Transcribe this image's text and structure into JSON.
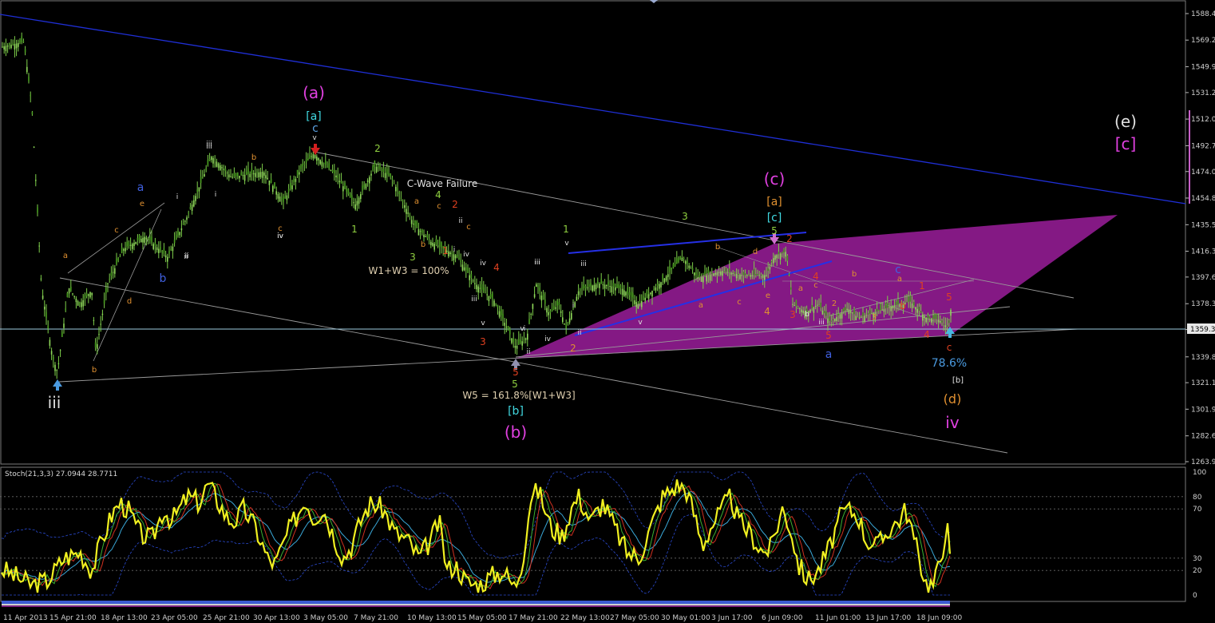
{
  "chart_data": {
    "type": "candlestick",
    "price_axis": {
      "ticks": [
        "1588.4",
        "1569.2",
        "1549.9",
        "1531.2",
        "1512.0",
        "1492.7",
        "1474.0",
        "1454.8",
        "1435.5",
        "1416.3",
        "1397.6",
        "1378.3",
        "1359.6",
        "1339.8",
        "1321.1",
        "1301.9",
        "1282.6",
        "1263.9"
      ],
      "range": [
        1259,
        1593
      ],
      "current_price_label": "1359.3"
    },
    "time_axis": {
      "labels": [
        "11 Apr 2013",
        "15 Apr 21:00",
        "18 Apr 13:00",
        "23 Apr 05:00",
        "25 Apr 21:00",
        "30 Apr 13:00",
        "3 May 05:00",
        "7 May 21:00",
        "10 May 13:00",
        "15 May 05:00",
        "17 May 21:00",
        "22 May 13:00",
        "27 May 05:00",
        "30 May 01:00",
        "3 Jun 17:00",
        "6 Jun 09:00",
        "11 Jun 01:00",
        "13 Jun 17:00",
        "18 Jun 09:00"
      ]
    },
    "price_path": [
      [
        0,
        1564
      ],
      [
        30,
        1568
      ],
      [
        40,
        1520
      ],
      [
        52,
        1390
      ],
      [
        66,
        1339
      ],
      [
        72,
        1329
      ],
      [
        86,
        1390
      ],
      [
        100,
        1378
      ],
      [
        115,
        1388
      ],
      [
        120,
        1343
      ],
      [
        135,
        1393
      ],
      [
        155,
        1418
      ],
      [
        182,
        1427
      ],
      [
        210,
        1412
      ],
      [
        235,
        1442
      ],
      [
        265,
        1485
      ],
      [
        290,
        1470
      ],
      [
        330,
        1474
      ],
      [
        355,
        1452
      ],
      [
        378,
        1477
      ],
      [
        393,
        1487
      ],
      [
        420,
        1472
      ],
      [
        445,
        1450
      ],
      [
        470,
        1478
      ],
      [
        490,
        1470
      ],
      [
        518,
        1436
      ],
      [
        540,
        1423
      ],
      [
        572,
        1413
      ],
      [
        595,
        1393
      ],
      [
        620,
        1380
      ],
      [
        646,
        1347
      ],
      [
        660,
        1354
      ],
      [
        672,
        1393
      ],
      [
        688,
        1371
      ],
      [
        700,
        1378
      ],
      [
        709,
        1360
      ],
      [
        715,
        1370
      ],
      [
        725,
        1388
      ],
      [
        750,
        1393
      ],
      [
        780,
        1389
      ],
      [
        800,
        1378
      ],
      [
        830,
        1395
      ],
      [
        855,
        1412
      ],
      [
        875,
        1397
      ],
      [
        905,
        1402
      ],
      [
        930,
        1399
      ],
      [
        960,
        1399
      ],
      [
        970,
        1413
      ],
      [
        985,
        1416
      ],
      [
        993,
        1378
      ],
      [
        1010,
        1372
      ],
      [
        1025,
        1378
      ],
      [
        1040,
        1365
      ],
      [
        1062,
        1375
      ],
      [
        1075,
        1368
      ],
      [
        1095,
        1372
      ],
      [
        1120,
        1377
      ],
      [
        1140,
        1380
      ],
      [
        1160,
        1368
      ],
      [
        1175,
        1367
      ],
      [
        1188,
        1361
      ],
      [
        1192,
        1378
      ]
    ],
    "oscillator": {
      "label": "Stoch(21,3,3) 27.0944 28.7711",
      "levels": [
        "100",
        "80",
        "70",
        "30",
        "20",
        "0"
      ],
      "value": 27.09,
      "signal": 28.77,
      "main_series": [
        [
          0,
          22
        ],
        [
          20,
          15
        ],
        [
          40,
          8
        ],
        [
          60,
          12
        ],
        [
          80,
          30
        ],
        [
          100,
          35
        ],
        [
          115,
          20
        ],
        [
          125,
          40
        ],
        [
          140,
          65
        ],
        [
          150,
          75
        ],
        [
          160,
          70
        ],
        [
          175,
          50
        ],
        [
          190,
          45
        ],
        [
          205,
          70
        ],
        [
          215,
          60
        ],
        [
          235,
          80
        ],
        [
          250,
          75
        ],
        [
          260,
          90
        ],
        [
          270,
          80
        ],
        [
          285,
          62
        ],
        [
          295,
          60
        ],
        [
          305,
          70
        ],
        [
          320,
          55
        ],
        [
          335,
          30
        ],
        [
          345,
          25
        ],
        [
          360,
          50
        ],
        [
          372,
          65
        ],
        [
          383,
          78
        ],
        [
          392,
          63
        ],
        [
          405,
          70
        ],
        [
          420,
          45
        ],
        [
          430,
          30
        ],
        [
          440,
          40
        ],
        [
          455,
          65
        ],
        [
          465,
          75
        ],
        [
          480,
          70
        ],
        [
          495,
          50
        ],
        [
          510,
          45
        ],
        [
          525,
          30
        ],
        [
          540,
          45
        ],
        [
          550,
          60
        ],
        [
          560,
          20
        ],
        [
          570,
          25
        ],
        [
          585,
          10
        ],
        [
          600,
          8
        ],
        [
          615,
          15
        ],
        [
          630,
          20
        ],
        [
          645,
          6
        ],
        [
          655,
          30
        ],
        [
          665,
          80
        ],
        [
          675,
          85
        ],
        [
          690,
          55
        ],
        [
          705,
          48
        ],
        [
          715,
          70
        ],
        [
          725,
          80
        ],
        [
          740,
          60
        ],
        [
          755,
          75
        ],
        [
          770,
          55
        ],
        [
          785,
          35
        ],
        [
          800,
          30
        ],
        [
          815,
          55
        ],
        [
          830,
          80
        ],
        [
          850,
          90
        ],
        [
          860,
          85
        ],
        [
          870,
          65
        ],
        [
          880,
          40
        ],
        [
          890,
          55
        ],
        [
          905,
          70
        ],
        [
          915,
          80
        ],
        [
          925,
          60
        ],
        [
          940,
          50
        ],
        [
          955,
          35
        ],
        [
          965,
          38
        ],
        [
          980,
          70
        ],
        [
          990,
          55
        ],
        [
          1000,
          25
        ],
        [
          1012,
          12
        ],
        [
          1025,
          20
        ],
        [
          1040,
          40
        ],
        [
          1050,
          60
        ],
        [
          1060,
          70
        ],
        [
          1075,
          65
        ],
        [
          1085,
          45
        ],
        [
          1100,
          40
        ],
        [
          1115,
          55
        ],
        [
          1125,
          60
        ],
        [
          1135,
          70
        ],
        [
          1145,
          45
        ],
        [
          1160,
          10
        ],
        [
          1170,
          8
        ],
        [
          1180,
          35
        ],
        [
          1186,
          60
        ],
        [
          1190,
          28
        ]
      ]
    },
    "wave_labels": [
      "(a)",
      "[a]",
      "c",
      "v",
      "iii",
      "ii",
      "i",
      "b",
      "a",
      "c",
      "e",
      "a",
      "b",
      "d",
      "b",
      "i",
      "iii",
      "ii",
      "iv",
      "c",
      "iv",
      "2",
      "1",
      "3",
      "4",
      "c",
      "2",
      "a",
      "b",
      "1",
      "c",
      "C-Wave Failure",
      "W1+W3 = 100%",
      "ii",
      "i",
      "iv",
      "v",
      "iii",
      "iv",
      "3",
      "4",
      "v",
      "iii",
      "5",
      "5",
      "W5 = 161.8%[W1+W3]",
      "[b]",
      "(b)",
      "ii",
      "i",
      "iii",
      "1",
      "v",
      "iii",
      "2",
      "iv",
      "i",
      "ii",
      "3",
      "v",
      "b",
      "a",
      "c",
      "d",
      "e",
      "4",
      "(c)",
      "[a]",
      "[c]",
      "5",
      "2",
      "4",
      "c",
      "a",
      "b",
      "iii",
      "3",
      "5",
      "a",
      "b",
      "c",
      "a",
      "2",
      "1",
      "b",
      "3",
      "4",
      "5",
      "c",
      "78.6%",
      "[b]",
      "(d)",
      "iv",
      "(e)",
      "[c]"
    ]
  }
}
